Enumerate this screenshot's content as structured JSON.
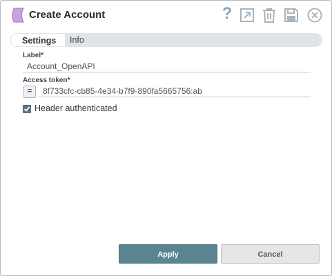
{
  "dialog": {
    "title": "Create Account"
  },
  "tabs": [
    {
      "label": "Settings"
    },
    {
      "label": "Info"
    }
  ],
  "form": {
    "label_field": {
      "label": "Label*",
      "value": "Account_OpenAPI"
    },
    "token_field": {
      "label": "Access token*",
      "value": "8f733cfc-cb85-4e34-b7f9-890fa5665756:ab",
      "expression_symbol": "="
    },
    "header_authenticated": {
      "label": "Header authenticated",
      "checked": true
    }
  },
  "buttons": {
    "apply": "Apply",
    "cancel": "Cancel"
  },
  "header_icons": {
    "help": "?",
    "names": [
      "help-icon",
      "export-icon",
      "delete-icon",
      "save-icon",
      "close-icon"
    ]
  },
  "colors": {
    "accent": "#5b8491",
    "snap_icon": "#c9a3e0",
    "icon_gray": "#a8b4be"
  }
}
